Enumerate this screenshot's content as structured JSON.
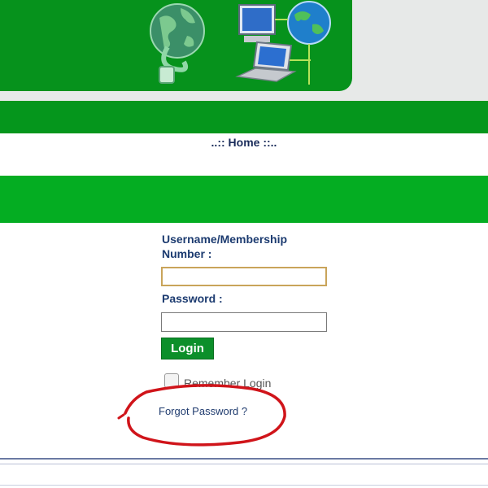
{
  "nav": {
    "home_label": "..:: Home ::.."
  },
  "login_form": {
    "username_label": "Username/Membership Number :",
    "username_value": "",
    "password_label": "Password :",
    "password_value": "",
    "login_button": "Login",
    "remember_label": "Remember Login",
    "remember_checked": false,
    "forgot_link": "Forgot Password ?"
  },
  "colors": {
    "banner_green": "#06921c",
    "bar_green": "#04ad22",
    "annotation_red": "#d0141a",
    "label_blue": "#1c3b70"
  },
  "icons": [
    "globe-icon",
    "ethernet-cable-icon",
    "desktop-computer-icon",
    "laptop-icon",
    "globe-icon"
  ]
}
